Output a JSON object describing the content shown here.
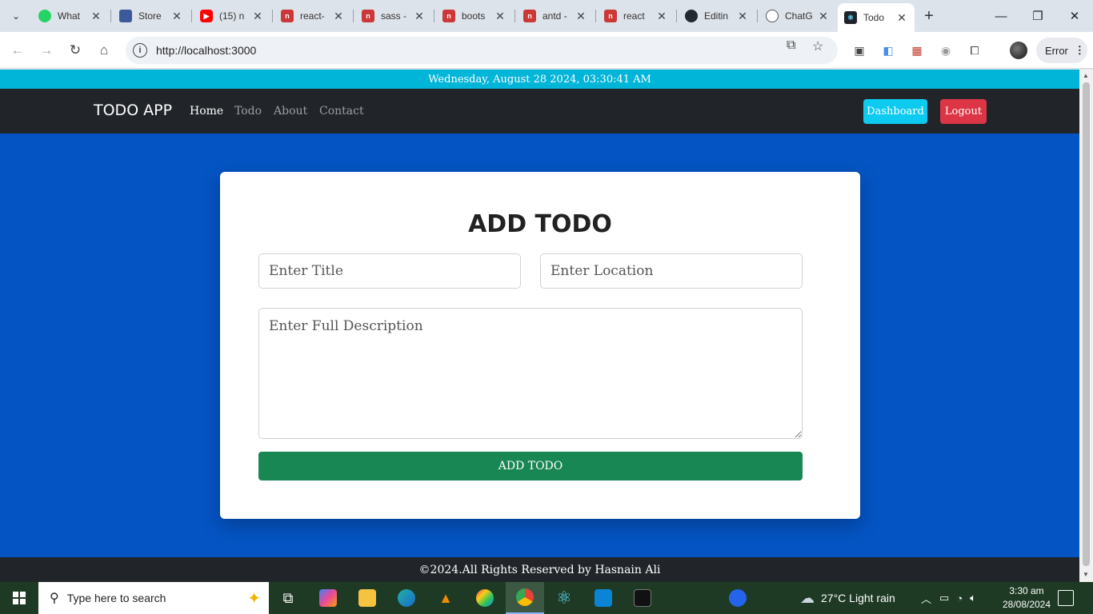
{
  "browser": {
    "tabs": [
      {
        "title": "What",
        "icon": "whatsapp-icon",
        "color": "#25d366"
      },
      {
        "title": "Store",
        "icon": "store-icon",
        "color": "#e07b39"
      },
      {
        "title": "(15) n",
        "icon": "youtube-icon",
        "color": "#ff0000"
      },
      {
        "title": "react-",
        "icon": "npm-icon",
        "color": "#cb3837"
      },
      {
        "title": "sass -",
        "icon": "npm-icon",
        "color": "#cb3837"
      },
      {
        "title": "boots",
        "icon": "npm-icon",
        "color": "#cb3837"
      },
      {
        "title": "antd -",
        "icon": "npm-icon",
        "color": "#cb3837"
      },
      {
        "title": "react",
        "icon": "npm-icon",
        "color": "#cb3837"
      },
      {
        "title": "Editin",
        "icon": "github-icon",
        "color": "#24292f"
      },
      {
        "title": "ChatG",
        "icon": "chatgpt-icon",
        "color": "#555555"
      },
      {
        "title": "Todo",
        "icon": "react-icon",
        "color": "#20232a",
        "active": true
      }
    ],
    "url": "http://localhost:3000",
    "error_label": "Error"
  },
  "page": {
    "datetime": "Wednesday, August 28 2024, 03:30:41 AM",
    "brand": "TODO APP",
    "nav": [
      "Home",
      "Todo",
      "About",
      "Contact"
    ],
    "dashboard_label": "Dashboard",
    "logout_label": "Logout",
    "form": {
      "heading": "ADD TODO",
      "title_placeholder": "Enter Title",
      "location_placeholder": "Enter Location",
      "description_placeholder": "Enter Full Description",
      "submit_label": "ADD TODO"
    },
    "footer": "©2024.All Rights Reserved by Hasnain Ali",
    "colors": {
      "datebar": "#00b5d8",
      "navbar": "#212529",
      "background": "#0454c3",
      "dashboard": "#0dcaf0",
      "logout": "#dc3545",
      "submit": "#198754"
    }
  },
  "taskbar": {
    "search_placeholder": "Type here to search",
    "weather": "27°C  Light rain",
    "time": "3:30 am",
    "date": "28/08/2024"
  }
}
